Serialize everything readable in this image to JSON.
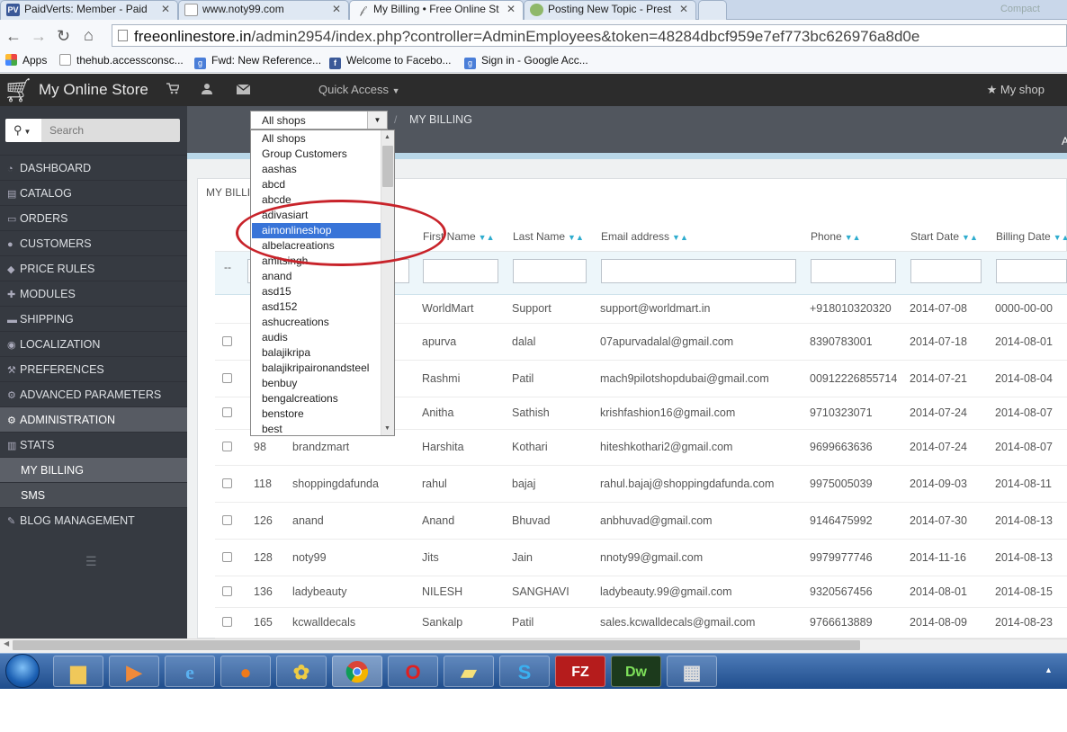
{
  "browser": {
    "tabs": [
      {
        "favicon": "PV",
        "title": "PaidVerts: Member - Paid",
        "active": false
      },
      {
        "favicon": "page-icon",
        "title": "www.noty99.com",
        "active": false
      },
      {
        "favicon": "prestashop-icon",
        "title": "My Billing • Free Online St",
        "active": true
      },
      {
        "favicon": "forum-icon",
        "title": "Posting New Topic - Prest",
        "active": false
      }
    ],
    "window_control": "Compact",
    "url_domain": "freeonlinestore.in",
    "url_path": "/admin2954/index.php?controller=AdminEmployees&token=48284dbcf959e7ef773bc626976a8d0e",
    "bookmarks": [
      {
        "label": "Apps",
        "icon": "apps-grid-icon"
      },
      {
        "label": "thehub.accessconsc...",
        "icon": "page-icon"
      },
      {
        "label": "Fwd: New Reference...",
        "icon": "google-icon"
      },
      {
        "label": "Welcome to Facebo...",
        "icon": "facebook-icon"
      },
      {
        "label": "Sign in - Google Acc...",
        "icon": "google-icon"
      }
    ]
  },
  "header": {
    "title": "My Online Store",
    "quick_access": "Quick Access",
    "my_shop": "My shop",
    "partial_right": "A"
  },
  "sidebar": {
    "search_placeholder": "Search",
    "items": [
      {
        "label": "DASHBOARD",
        "icon": "dashboard-icon"
      },
      {
        "label": "CATALOG",
        "icon": "book-icon"
      },
      {
        "label": "ORDERS",
        "icon": "credit-card-icon"
      },
      {
        "label": "CUSTOMERS",
        "icon": "users-icon"
      },
      {
        "label": "PRICE RULES",
        "icon": "tag-icon"
      },
      {
        "label": "MODULES",
        "icon": "puzzle-icon"
      },
      {
        "label": "SHIPPING",
        "icon": "truck-icon"
      },
      {
        "label": "LOCALIZATION",
        "icon": "globe-icon"
      },
      {
        "label": "PREFERENCES",
        "icon": "wrench-icon"
      },
      {
        "label": "ADVANCED PARAMETERS",
        "icon": "cogs-icon"
      },
      {
        "label": "ADMINISTRATION",
        "icon": "gear-icon"
      },
      {
        "label": "STATS",
        "icon": "bar-chart-icon"
      },
      {
        "label": "MY BILLING",
        "icon": ""
      },
      {
        "label": "SMS",
        "icon": ""
      },
      {
        "label": "BLOG MANAGEMENT",
        "icon": "pencil-icon"
      }
    ]
  },
  "breadcrumb": {
    "shop_select_value": "All shops",
    "separator": "/",
    "title": "MY BILLING"
  },
  "panel_title": "MY BILLI",
  "shop_dropdown": {
    "highlighted": "aimonlineshop",
    "options": [
      "All shops",
      "Group Customers",
      "aashas",
      "abcd",
      "abcde",
      "adivasiart",
      "aimonlineshop",
      "albelacreations",
      "amitsingh",
      "anand",
      "asd15",
      "asd152",
      "ashucreations",
      "audis",
      "balajikripa",
      "balajikripaironandsteel",
      "benbuy",
      "bengalcreations",
      "benstore",
      "best"
    ]
  },
  "table": {
    "columns": [
      "First Name",
      "Last Name",
      "Email address",
      "Phone",
      "Start Date",
      "Billing Date"
    ],
    "filter_placeholder": "--",
    "rows": [
      {
        "id": "",
        "shop": "",
        "first": "WorldMart",
        "last": "Support",
        "email": "support@worldmart.in",
        "phone": "+918010320320",
        "start": "2014-07-08",
        "billing": "0000-00-00",
        "checkbox": false
      },
      {
        "id": "",
        "shop": "",
        "first": "apurva",
        "last": "dalal",
        "email": "07apurvadalal@gmail.com",
        "phone": "8390783001",
        "start": "2014-07-18",
        "billing": "2014-08-01",
        "checkbox": true
      },
      {
        "id": "",
        "shop": "",
        "first": "Rashmi",
        "last": "Patil",
        "email": "mach9pilotshopdubai@gmail.com",
        "phone": "00912226855714",
        "start": "2014-07-21",
        "billing": "2014-08-04",
        "checkbox": true
      },
      {
        "id": "",
        "shop": "",
        "first": "Anitha",
        "last": "Sathish",
        "email": "krishfashion16@gmail.com",
        "phone": "9710323071",
        "start": "2014-07-24",
        "billing": "2014-08-07",
        "checkbox": true
      },
      {
        "id": "98",
        "shop": "brandzmart",
        "first": "Harshita",
        "last": "Kothari",
        "email": "hiteshkothari2@gmail.com",
        "phone": "9699663636",
        "start": "2014-07-24",
        "billing": "2014-08-07",
        "checkbox": true
      },
      {
        "id": "118",
        "shop": "shoppingdafunda",
        "first": "rahul",
        "last": "bajaj",
        "email": "rahul.bajaj@shoppingdafunda.com",
        "phone": "9975005039",
        "start": "2014-09-03",
        "billing": "2014-08-11",
        "checkbox": true
      },
      {
        "id": "126",
        "shop": "anand",
        "first": "Anand",
        "last": "Bhuvad",
        "email": "anbhuvad@gmail.com",
        "phone": "9146475992",
        "start": "2014-07-30",
        "billing": "2014-08-13",
        "checkbox": true
      },
      {
        "id": "128",
        "shop": "noty99",
        "first": "Jits",
        "last": "Jain",
        "email": "nnoty99@gmail.com",
        "phone": "9979977746",
        "start": "2014-11-16",
        "billing": "2014-08-13",
        "checkbox": true
      },
      {
        "id": "136",
        "shop": "ladybeauty",
        "first": "NILESH",
        "last": "SANGHAVI",
        "email": "ladybeauty.99@gmail.com",
        "phone": "9320567456",
        "start": "2014-08-01",
        "billing": "2014-08-15",
        "checkbox": true
      },
      {
        "id": "165",
        "shop": "kcwalldecals",
        "first": "Sankalp",
        "last": "Patil",
        "email": "sales.kcwalldecals@gmail.com",
        "phone": "9766613889",
        "start": "2014-08-09",
        "billing": "2014-08-23",
        "checkbox": true
      }
    ]
  },
  "taskbar": {
    "items": [
      "explorer-icon",
      "media-player-icon",
      "internet-explorer-icon",
      "firefox-icon",
      "picasa-icon",
      "chrome-icon",
      "opera-icon",
      "sticky-notes-icon",
      "skype-icon",
      "filezilla-icon",
      "dreamweaver-icon",
      "calculator-icon"
    ],
    "filezilla_label": "FZ",
    "dreamweaver_label": "Dw"
  },
  "colors": {
    "accent": "#2eacce",
    "sidebar": "#363a41",
    "header": "#2c2c2c",
    "highlight": "#3874d8",
    "annotation": "#c8232a"
  }
}
